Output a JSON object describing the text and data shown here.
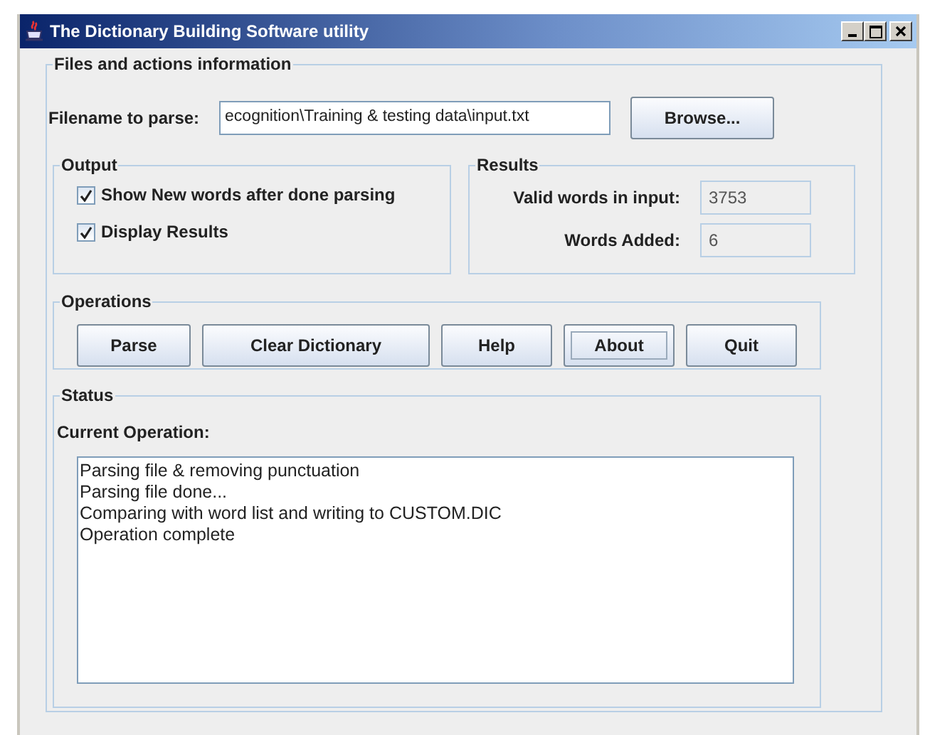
{
  "window": {
    "title": "The Dictionary Building Software utility"
  },
  "files_group": {
    "title": "Files and actions information",
    "filename_label": "Filename to parse:",
    "filename_value": "ecognition\\Training & testing data\\input.txt",
    "browse": "Browse..."
  },
  "output_group": {
    "title": "Output",
    "options": [
      {
        "label": "Show New words after done parsing",
        "checked": true
      },
      {
        "label": "Display Results",
        "checked": true
      }
    ]
  },
  "results_group": {
    "title": "Results",
    "fields": [
      {
        "label": "Valid words in input:",
        "value": "3753"
      },
      {
        "label": "Words Added:",
        "value": "6"
      }
    ]
  },
  "operations_group": {
    "title": "Operations",
    "buttons": [
      {
        "label": "Parse",
        "focused": false
      },
      {
        "label": "Clear Dictionary",
        "focused": false
      },
      {
        "label": "Help",
        "focused": false
      },
      {
        "label": "About",
        "focused": true
      },
      {
        "label": "Quit",
        "focused": false
      }
    ]
  },
  "status_group": {
    "title": "Status",
    "label": "Current Operation:",
    "log": [
      "Parsing file & removing punctuation",
      "Parsing file done...",
      "Comparing with word list and writing to CUSTOM.DIC",
      "Operation complete"
    ]
  }
}
